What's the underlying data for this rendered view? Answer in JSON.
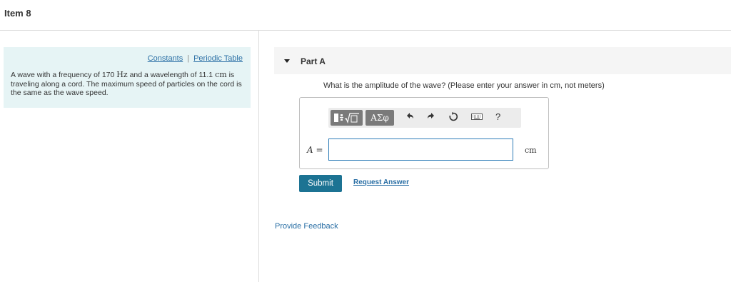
{
  "item": {
    "title": "Item 8"
  },
  "sidebar": {
    "links": [
      "Constants",
      "Periodic Table"
    ],
    "separator": "|",
    "problem": {
      "t1": "A wave with a frequency of 170 ",
      "freq_unit": "Hz",
      "t2": " and a wavelength of 11.1 ",
      "len_unit": "cm",
      "t3": " is traveling along a cord. The maximum speed of particles on the cord is the same as the wave speed."
    }
  },
  "part": {
    "title": "Part A",
    "question": "What is the amplitude of the wave? (Please enter your answer in cm, not meters)",
    "toolbar": {
      "greek_label": "ΑΣφ",
      "icons": [
        "templates-icon",
        "greek-symbols-icon",
        "undo-icon",
        "redo-icon",
        "reset-icon",
        "keyboard-icon",
        "help-icon"
      ],
      "help_label": "?"
    },
    "answer": {
      "label": "A =",
      "value": "",
      "unit": "cm"
    },
    "submit_label": "Submit",
    "request_label": "Request Answer"
  },
  "feedback_label": "Provide Feedback"
}
